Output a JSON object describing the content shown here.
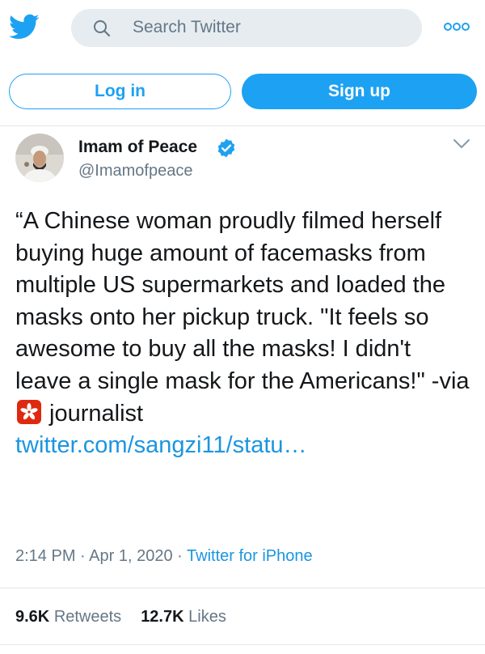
{
  "header": {
    "search_placeholder": "Search Twitter"
  },
  "auth": {
    "login_label": "Log in",
    "signup_label": "Sign up"
  },
  "tweet": {
    "author_name": "Imam of Peace",
    "author_handle": "@Imamofpeace",
    "text_part1": "“A Chinese woman proudly filmed herself buying huge amount of facemasks from multiple US supermarkets and loaded the masks onto her pickup truck. \"It feels so awesome to buy all the masks! I didn't leave a single mask for the Americans!\" -via ",
    "flag_icon": "hong-kong-flag-icon",
    "text_part2": " journalist",
    "link_text": "twitter.com/sangzi11/statu…",
    "time": "2:14 PM",
    "date": "Apr 1, 2020",
    "source": "Twitter for iPhone",
    "retweets_count": "9.6K",
    "retweets_label": "Retweets",
    "likes_count": "12.7K",
    "likes_label": "Likes"
  },
  "colors": {
    "brand": "#1da1f2",
    "link": "#1b95e0",
    "muted": "#657786",
    "search_bg": "#e6ecf0"
  }
}
